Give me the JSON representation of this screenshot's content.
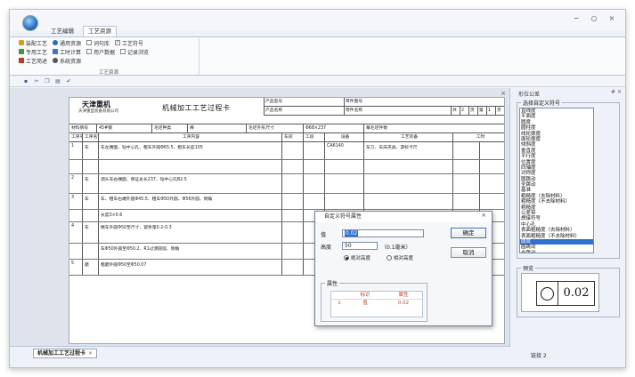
{
  "window": {
    "minimize": "−",
    "maximize": "○",
    "close": "×"
  },
  "ribbon_tabs": [
    "工艺编辑",
    "工艺资源"
  ],
  "ribbon": {
    "row1": [
      {
        "label": "装配工艺",
        "icon": "assembly-icon"
      },
      {
        "label": "通用资源",
        "icon": "resource-icon"
      },
      {
        "label": "词句库",
        "icon": "checkbox"
      },
      {
        "label": "工艺符号",
        "icon": "checkbox-checked"
      }
    ],
    "row2": [
      {
        "label": "专用工艺",
        "icon": "special-icon"
      },
      {
        "label": "工时计算",
        "icon": "calc-icon"
      },
      {
        "label": "用户数据",
        "icon": "checkbox"
      },
      {
        "label": "记录浏览",
        "icon": "checkbox"
      }
    ],
    "row3": [
      {
        "label": "工艺简述",
        "icon": "brief-icon"
      },
      {
        "label": "系统资源",
        "icon": "system-icon"
      }
    ],
    "group_label": "工艺资源"
  },
  "quickbar": [
    "save",
    "cut",
    "copy",
    "paste",
    "check"
  ],
  "document": {
    "close_glyph": "×",
    "logo": "天津重机",
    "logo_sub": "天津重型装备有限公司",
    "title": "机械加工工艺过程卡",
    "header_cells": [
      {
        "l": "产品型号",
        "r": "零件图号"
      },
      {
        "l": "产品名称",
        "r": "零件名称"
      }
    ],
    "header_extra": [
      "共",
      "2",
      "页",
      "第",
      "1",
      "页"
    ],
    "info": [
      {
        "label": "材料牌号",
        "value": "45#钢"
      },
      {
        "label": "毛坯种类",
        "value": "棒"
      },
      {
        "label": "毛坯外形尺寸",
        "value": "Φ68×237"
      },
      {
        "label": "每毛坯件数",
        "value": "备注"
      }
    ],
    "col_heads": [
      "工序号",
      "工序名称",
      "工序内容",
      "车间",
      "工段",
      "设备",
      "工艺装备",
      "工时"
    ],
    "col_sub": [
      "准终",
      "单件"
    ],
    "rows": [
      {
        "no": "1",
        "name": "车",
        "content": "车左端面、钻中心孔、粗车外圆Φ65.5、粗车长度105",
        "eq": "CA6140",
        "tool": "车刀、车床夹具、游标卡尺"
      },
      {
        "no": "",
        "name": "",
        "content": "",
        "eq": "",
        "tool": ""
      },
      {
        "no": "2",
        "name": "车",
        "content": "调头车右端面、保证总长237、钻中心孔B2.5",
        "eq": "",
        "tool": ""
      },
      {
        "no": "3",
        "name": "车",
        "content": "车、粗车右端外圆Φ45.5、粗车Φ50外圆、Φ56外圆、倒角",
        "eq": "",
        "tool": ""
      },
      {
        "no": "",
        "name": "",
        "content": "长度3×0.6",
        "eq": "",
        "tool": ""
      },
      {
        "no": "4",
        "name": "车",
        "content": "精车外圆Φ50至尺寸、留余量0.2-0.3",
        "eq": "",
        "tool": ""
      },
      {
        "no": "",
        "name": "",
        "content": "车Φ50外圆至Φ50.2、R1过渡圆弧、倒角",
        "eq": "",
        "tool": ""
      },
      {
        "no": "5",
        "name": "磨",
        "content": "粗磨外圆Φ50至Φ50.07",
        "eq": "",
        "tool": ""
      }
    ],
    "tab_label": "机械加工工艺过程卡",
    "tab_close": "×"
  },
  "side_panel": {
    "title": "形位公差",
    "pin": "# ×",
    "list_legend": "选择自定义符号",
    "symbols": [
      "直线度",
      "平面度",
      "圆度",
      "圆柱度",
      "线轮廓度",
      "面轮廓度",
      "倾斜度",
      "垂直度",
      "平行度",
      "位置度",
      "同轴度",
      "对称度",
      "圆跳动",
      "全跳动",
      "基准",
      "粗糙度（去除材料）",
      "粗糙度（不去除材料）",
      "粗糙度",
      "公差带",
      "焊接符号",
      "中心孔",
      "表面粗糙度（去除材料）",
      "表面粗糙度（不去除材料）",
      "圆度",
      "圆跳动",
      "全跳动"
    ],
    "selected_index": 23,
    "preview_legend": "预览",
    "preview_value": "0.02",
    "bottom_label": "链接 2"
  },
  "dialog": {
    "title": "自定义符号属性",
    "close": "×",
    "value_label": "值",
    "value": "0.02",
    "height_label": "高度",
    "height_value": "50",
    "unit": "（0.1毫米）",
    "radio1": "绝对高度",
    "radio2": "相对高度",
    "ok": "确定",
    "cancel": "取消",
    "attr_legend": "属性",
    "attr_headers": [
      "标识",
      "属性"
    ],
    "attr_row": {
      "idx": "1",
      "name": "值",
      "value": "0.02"
    }
  }
}
